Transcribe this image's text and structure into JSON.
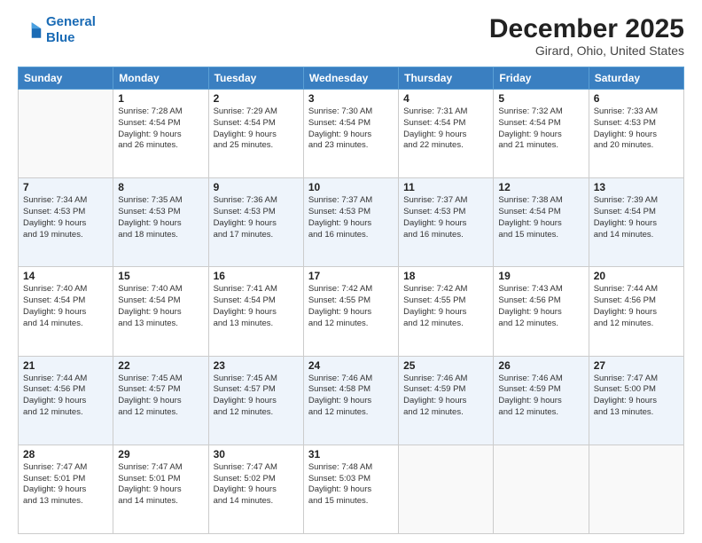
{
  "logo": {
    "line1": "General",
    "line2": "Blue"
  },
  "header": {
    "month": "December 2025",
    "location": "Girard, Ohio, United States"
  },
  "weekdays": [
    "Sunday",
    "Monday",
    "Tuesday",
    "Wednesday",
    "Thursday",
    "Friday",
    "Saturday"
  ],
  "weeks": [
    [
      {
        "day": "",
        "info": ""
      },
      {
        "day": "1",
        "info": "Sunrise: 7:28 AM\nSunset: 4:54 PM\nDaylight: 9 hours\nand 26 minutes."
      },
      {
        "day": "2",
        "info": "Sunrise: 7:29 AM\nSunset: 4:54 PM\nDaylight: 9 hours\nand 25 minutes."
      },
      {
        "day": "3",
        "info": "Sunrise: 7:30 AM\nSunset: 4:54 PM\nDaylight: 9 hours\nand 23 minutes."
      },
      {
        "day": "4",
        "info": "Sunrise: 7:31 AM\nSunset: 4:54 PM\nDaylight: 9 hours\nand 22 minutes."
      },
      {
        "day": "5",
        "info": "Sunrise: 7:32 AM\nSunset: 4:54 PM\nDaylight: 9 hours\nand 21 minutes."
      },
      {
        "day": "6",
        "info": "Sunrise: 7:33 AM\nSunset: 4:53 PM\nDaylight: 9 hours\nand 20 minutes."
      }
    ],
    [
      {
        "day": "7",
        "info": "Sunrise: 7:34 AM\nSunset: 4:53 PM\nDaylight: 9 hours\nand 19 minutes."
      },
      {
        "day": "8",
        "info": "Sunrise: 7:35 AM\nSunset: 4:53 PM\nDaylight: 9 hours\nand 18 minutes."
      },
      {
        "day": "9",
        "info": "Sunrise: 7:36 AM\nSunset: 4:53 PM\nDaylight: 9 hours\nand 17 minutes."
      },
      {
        "day": "10",
        "info": "Sunrise: 7:37 AM\nSunset: 4:53 PM\nDaylight: 9 hours\nand 16 minutes."
      },
      {
        "day": "11",
        "info": "Sunrise: 7:37 AM\nSunset: 4:53 PM\nDaylight: 9 hours\nand 16 minutes."
      },
      {
        "day": "12",
        "info": "Sunrise: 7:38 AM\nSunset: 4:54 PM\nDaylight: 9 hours\nand 15 minutes."
      },
      {
        "day": "13",
        "info": "Sunrise: 7:39 AM\nSunset: 4:54 PM\nDaylight: 9 hours\nand 14 minutes."
      }
    ],
    [
      {
        "day": "14",
        "info": "Sunrise: 7:40 AM\nSunset: 4:54 PM\nDaylight: 9 hours\nand 14 minutes."
      },
      {
        "day": "15",
        "info": "Sunrise: 7:40 AM\nSunset: 4:54 PM\nDaylight: 9 hours\nand 13 minutes."
      },
      {
        "day": "16",
        "info": "Sunrise: 7:41 AM\nSunset: 4:54 PM\nDaylight: 9 hours\nand 13 minutes."
      },
      {
        "day": "17",
        "info": "Sunrise: 7:42 AM\nSunset: 4:55 PM\nDaylight: 9 hours\nand 12 minutes."
      },
      {
        "day": "18",
        "info": "Sunrise: 7:42 AM\nSunset: 4:55 PM\nDaylight: 9 hours\nand 12 minutes."
      },
      {
        "day": "19",
        "info": "Sunrise: 7:43 AM\nSunset: 4:56 PM\nDaylight: 9 hours\nand 12 minutes."
      },
      {
        "day": "20",
        "info": "Sunrise: 7:44 AM\nSunset: 4:56 PM\nDaylight: 9 hours\nand 12 minutes."
      }
    ],
    [
      {
        "day": "21",
        "info": "Sunrise: 7:44 AM\nSunset: 4:56 PM\nDaylight: 9 hours\nand 12 minutes."
      },
      {
        "day": "22",
        "info": "Sunrise: 7:45 AM\nSunset: 4:57 PM\nDaylight: 9 hours\nand 12 minutes."
      },
      {
        "day": "23",
        "info": "Sunrise: 7:45 AM\nSunset: 4:57 PM\nDaylight: 9 hours\nand 12 minutes."
      },
      {
        "day": "24",
        "info": "Sunrise: 7:46 AM\nSunset: 4:58 PM\nDaylight: 9 hours\nand 12 minutes."
      },
      {
        "day": "25",
        "info": "Sunrise: 7:46 AM\nSunset: 4:59 PM\nDaylight: 9 hours\nand 12 minutes."
      },
      {
        "day": "26",
        "info": "Sunrise: 7:46 AM\nSunset: 4:59 PM\nDaylight: 9 hours\nand 12 minutes."
      },
      {
        "day": "27",
        "info": "Sunrise: 7:47 AM\nSunset: 5:00 PM\nDaylight: 9 hours\nand 13 minutes."
      }
    ],
    [
      {
        "day": "28",
        "info": "Sunrise: 7:47 AM\nSunset: 5:01 PM\nDaylight: 9 hours\nand 13 minutes."
      },
      {
        "day": "29",
        "info": "Sunrise: 7:47 AM\nSunset: 5:01 PM\nDaylight: 9 hours\nand 14 minutes."
      },
      {
        "day": "30",
        "info": "Sunrise: 7:47 AM\nSunset: 5:02 PM\nDaylight: 9 hours\nand 14 minutes."
      },
      {
        "day": "31",
        "info": "Sunrise: 7:48 AM\nSunset: 5:03 PM\nDaylight: 9 hours\nand 15 minutes."
      },
      {
        "day": "",
        "info": ""
      },
      {
        "day": "",
        "info": ""
      },
      {
        "day": "",
        "info": ""
      }
    ]
  ]
}
